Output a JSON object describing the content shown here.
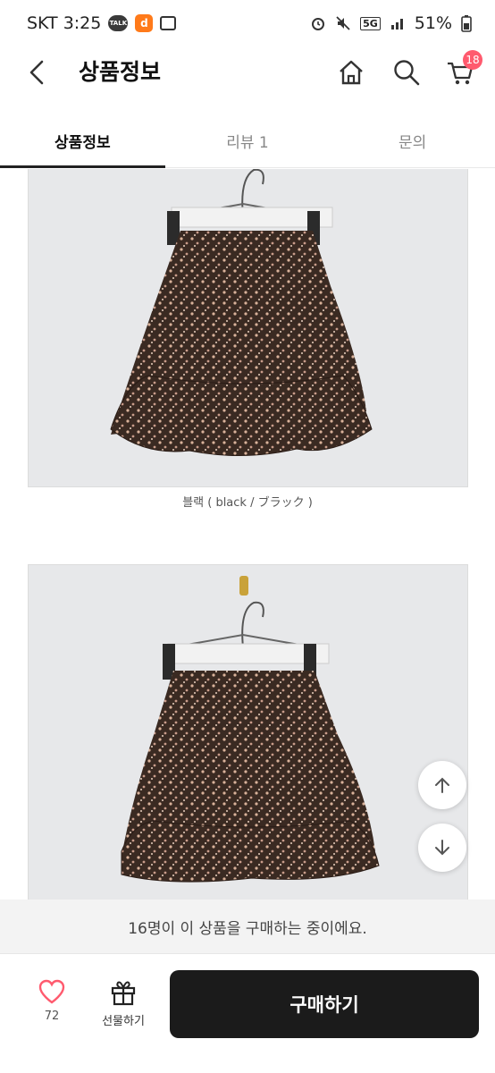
{
  "status_bar": {
    "carrier_time": "SKT 3:25",
    "talk_icon_label": "TALK",
    "app_icon_label": "d",
    "network": "5G",
    "battery": "51%"
  },
  "header": {
    "title": "상품정보",
    "cart_count": "18"
  },
  "tabs": [
    {
      "label": "상품정보",
      "active": true
    },
    {
      "label": "리뷰 1",
      "active": false
    },
    {
      "label": "문의",
      "active": false
    }
  ],
  "content": {
    "photo1_caption": "블랙 ( black / ブラック )",
    "notice": "16명이 이 상품을 구매하는 중이에요."
  },
  "bottom_bar": {
    "like_count": "72",
    "gift_label": "선물하기",
    "buy_label": "구매하기"
  },
  "colors": {
    "badge": "#ff5a6e",
    "buy_button": "#1b1b1b",
    "like_icon": "#ff5a6e"
  }
}
